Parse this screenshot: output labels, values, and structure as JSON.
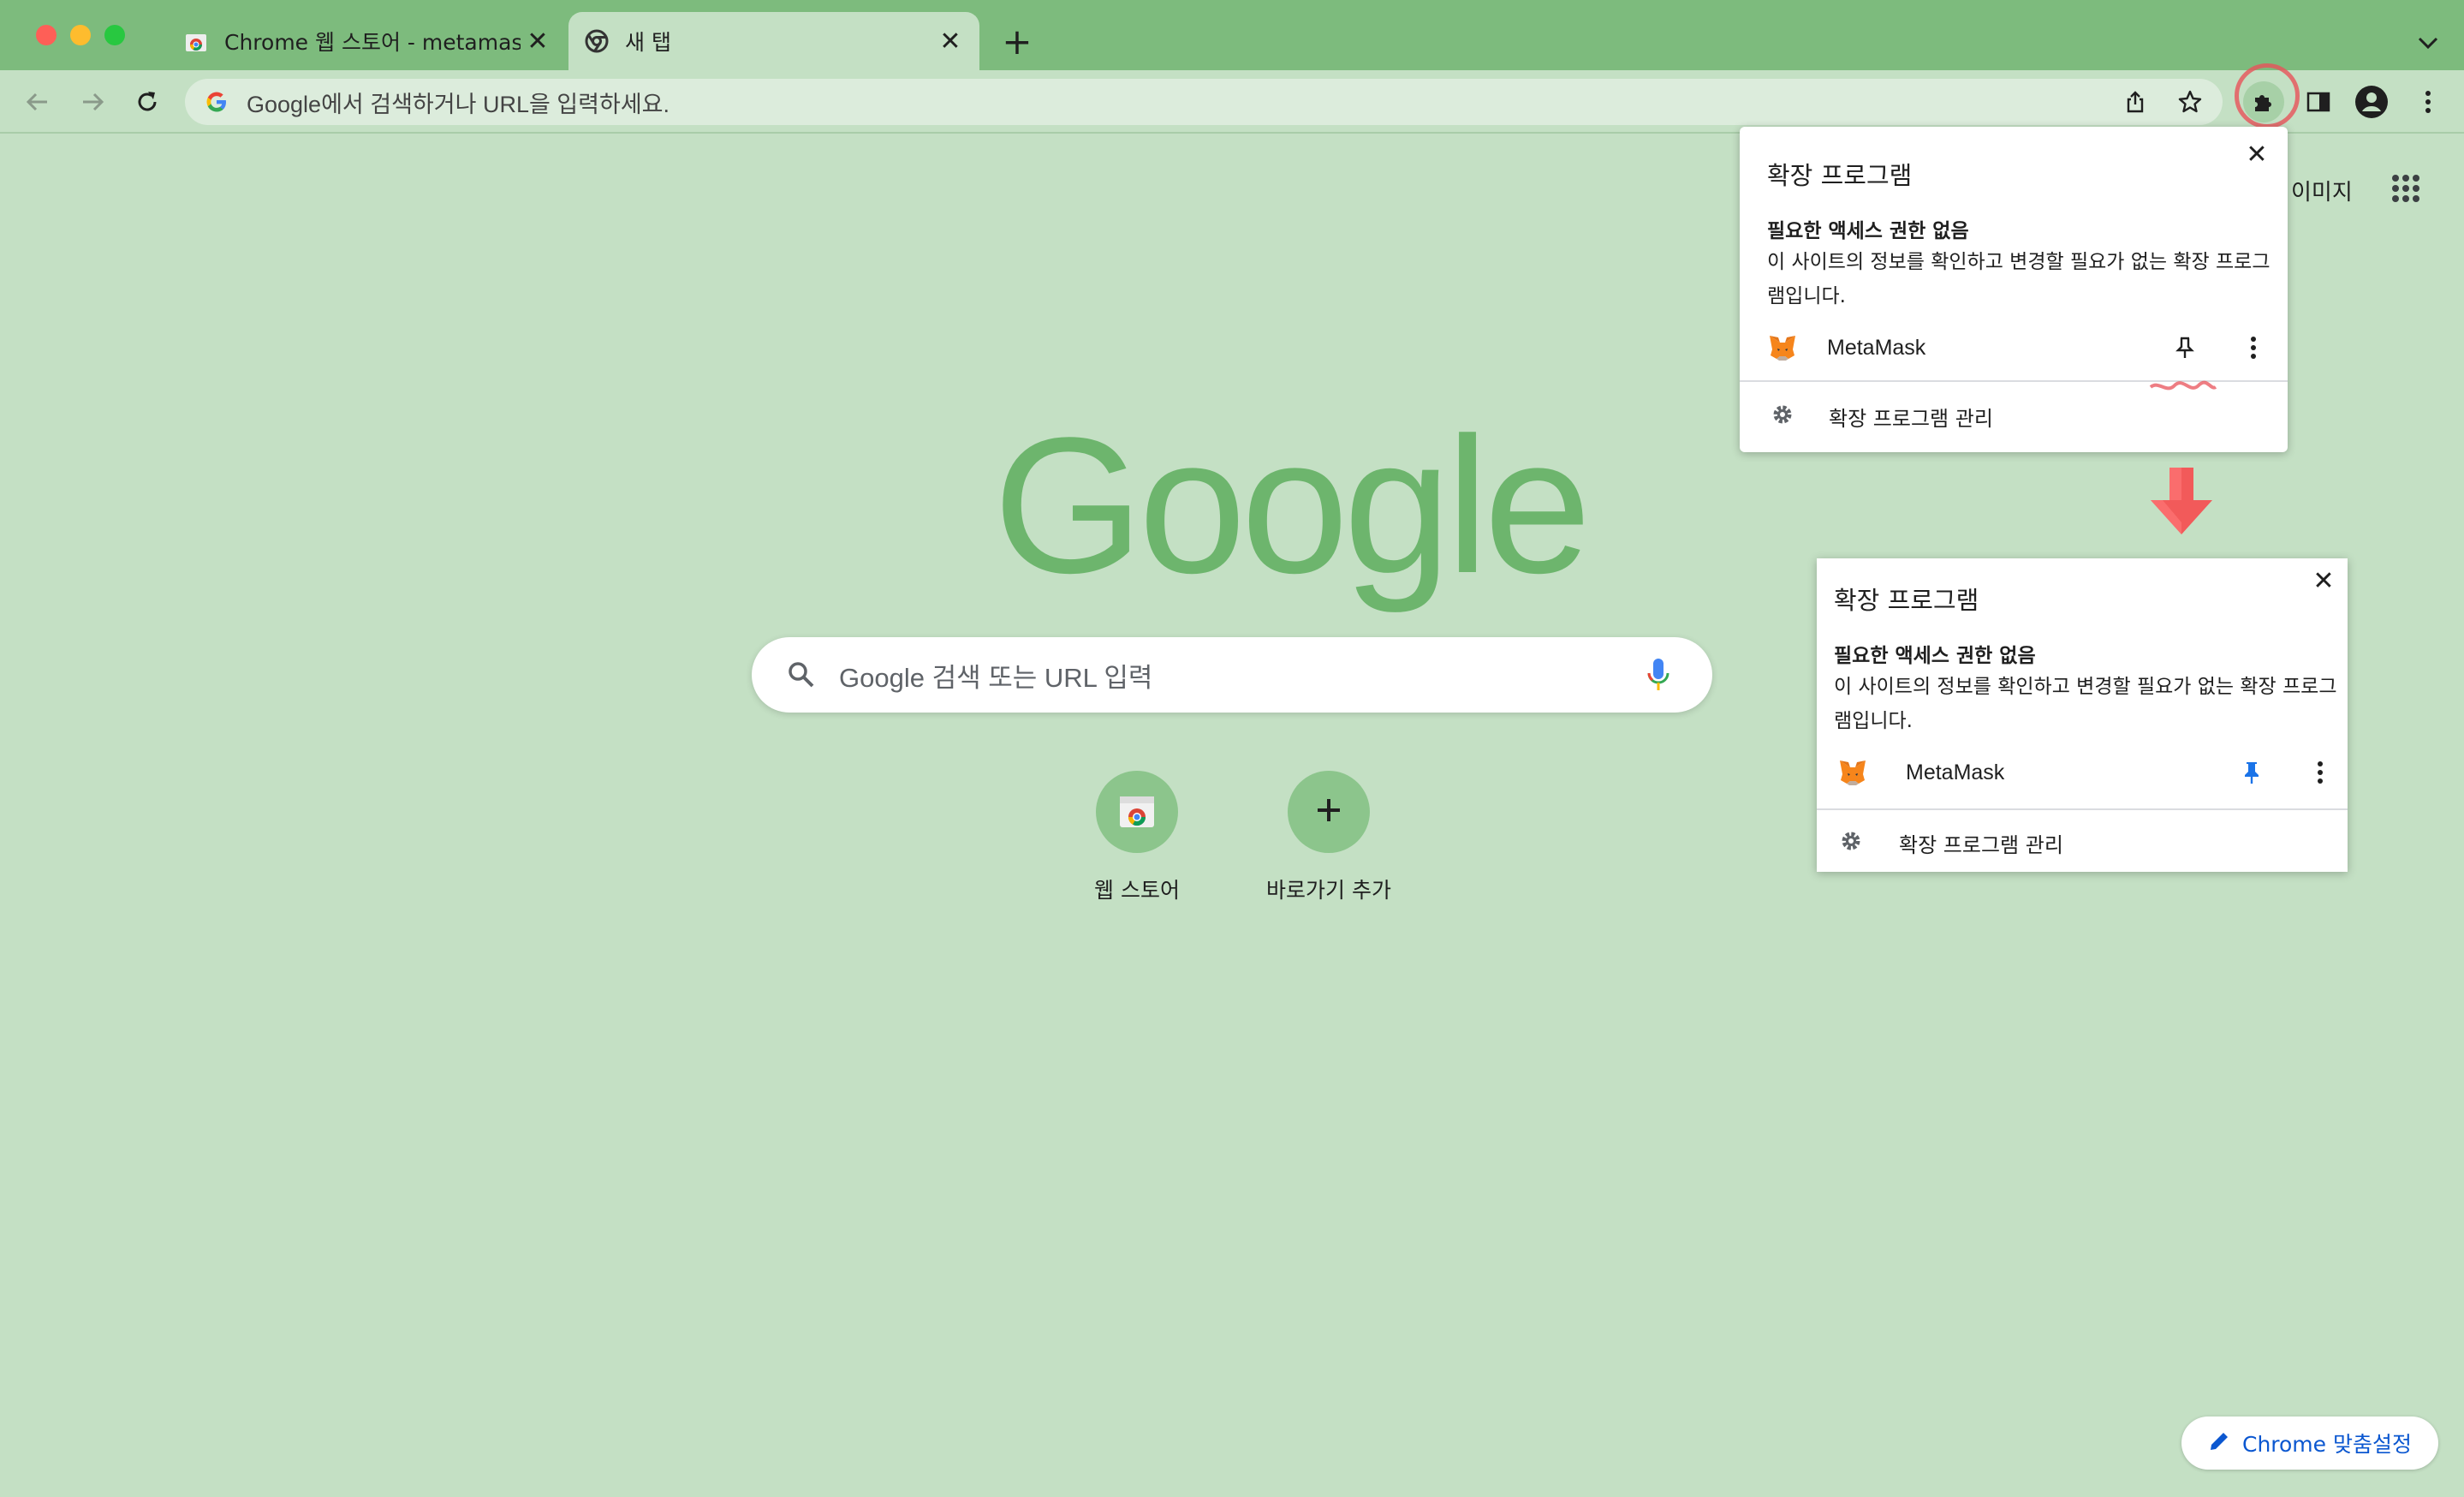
{
  "tabs": [
    {
      "title": "Chrome 웹 스토어 - metamask",
      "favicon": "chrome-web-store-icon"
    },
    {
      "title": "새 탭",
      "favicon": "chrome-icon",
      "active": true
    }
  ],
  "toolbar": {
    "omnibox_placeholder": "Google에서 검색하거나 URL을 입력하세요."
  },
  "ntp": {
    "images_link": "이미지",
    "logo": "Google",
    "search_placeholder": "Google 검색 또는 URL 입력",
    "shortcuts": [
      {
        "label": "웹 스토어",
        "icon": "chrome-web-store-icon"
      },
      {
        "label": "바로가기 추가",
        "icon": "plus-icon"
      }
    ],
    "customize_label": "Chrome 맞춤설정"
  },
  "popup_unpinned": {
    "title": "확장 프로그램",
    "subtitle": "필요한 액세스 권한 없음",
    "description": "이 사이트의 정보를 확인하고 변경할 필요가 없는 확장 프로그램입니다.",
    "extension_name": "MetaMask",
    "pinned": false,
    "manage_label": "확장 프로그램 관리"
  },
  "popup_pinned": {
    "title": "확장 프로그램",
    "subtitle": "필요한 액세스 권한 없음",
    "description": "이 사이트의 정보를 확인하고 변경할 필요가 없는 확장 프로그램입니다.",
    "extension_name": "MetaMask",
    "pinned": true,
    "manage_label": "확장 프로그램 관리"
  },
  "colors": {
    "tabstrip": "#7dbb7d",
    "background": "#c4e0c4",
    "pin_active": "#1a73e8",
    "annotation_red": "#e8525a"
  }
}
